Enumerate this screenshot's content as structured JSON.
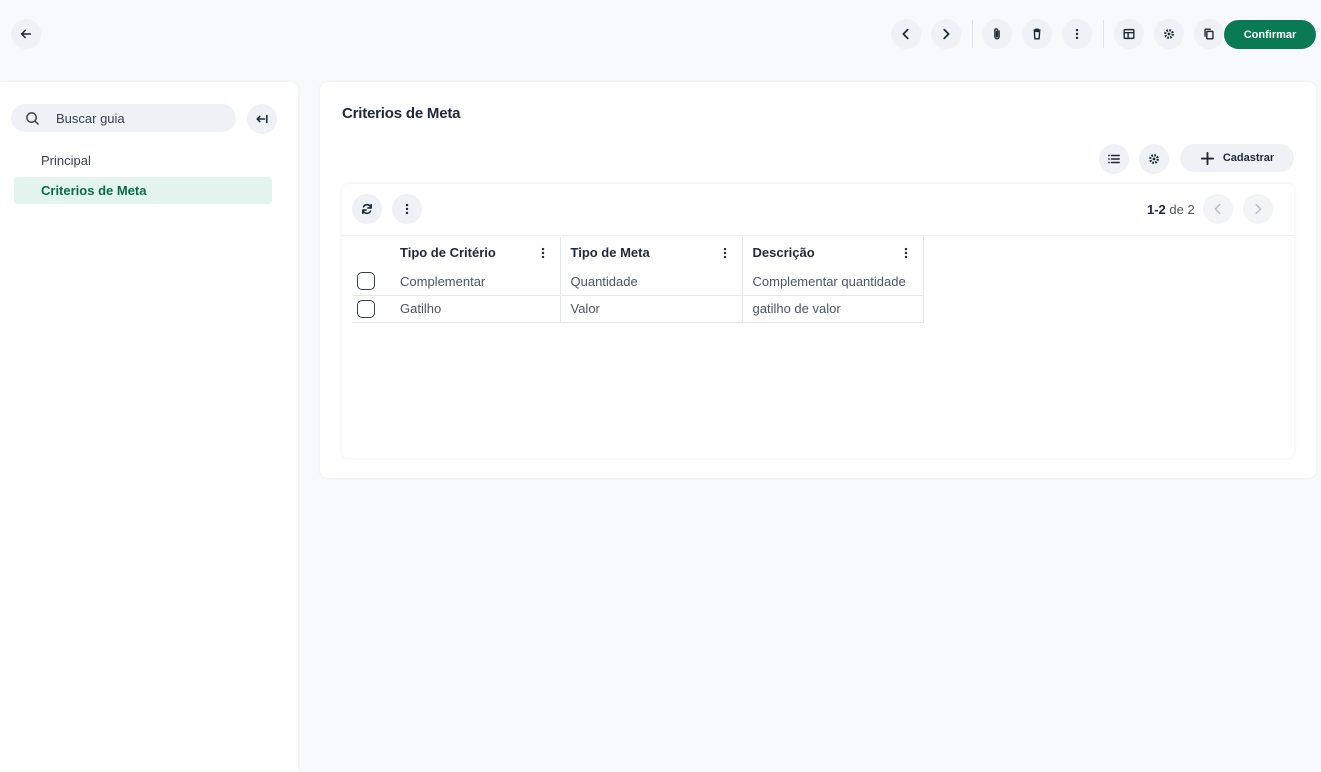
{
  "toolbar": {
    "confirm_label": "Confirmar"
  },
  "sidebar": {
    "search_placeholder": "Buscar guia",
    "items": [
      {
        "label": "Principal",
        "active": false
      },
      {
        "label": "Criterios de Meta",
        "active": true
      }
    ]
  },
  "main": {
    "title": "Criterios de Meta",
    "cadastrar_label": "Cadastrar",
    "pager": {
      "range": "1-2",
      "of_label": "de",
      "total": "2"
    },
    "table": {
      "columns": [
        "Tipo de Critério",
        "Tipo de Meta",
        "Descrição"
      ],
      "rows": [
        [
          "Complementar",
          "Quantidade",
          "Complementar quantidade"
        ],
        [
          "Gatilho",
          "Valor",
          "gatilho de valor"
        ]
      ]
    }
  },
  "colors": {
    "accent": "#0a7a55",
    "active_bg": "#e3f4ee",
    "button_bg": "#eef1f5"
  }
}
